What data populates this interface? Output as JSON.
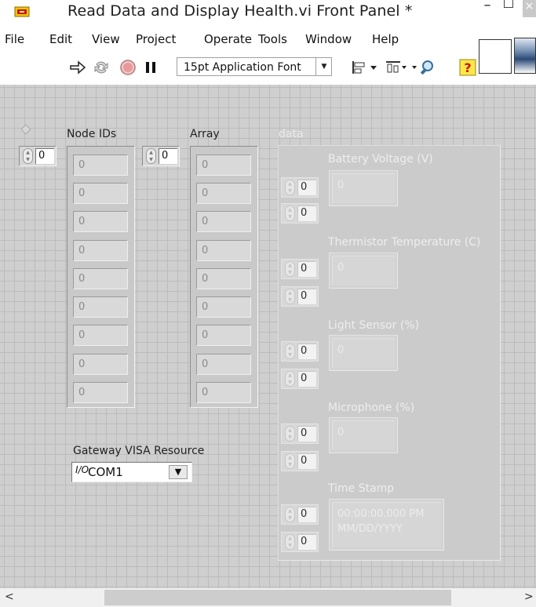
{
  "window": {
    "title": "Read Data and Display Health.vi Front Panel *",
    "minimize_glyph": "–",
    "close_glyph": "×"
  },
  "menu": [
    "File",
    "Edit",
    "View",
    "Project",
    "Operate",
    "Tools",
    "Window",
    "Help"
  ],
  "toolbar": {
    "font": "15pt Application Font",
    "icons": [
      "run-arrow-icon",
      "run-continuously-icon",
      "abort-icon",
      "pause-icon",
      "align-objects-icon",
      "distribute-objects-icon",
      "zoom-icon",
      "context-help-icon"
    ]
  },
  "panel": {
    "node_ids": {
      "label": "Node IDs",
      "index": "0",
      "elements": [
        "0",
        "0",
        "0",
        "0",
        "0",
        "0",
        "0",
        "0",
        "0"
      ]
    },
    "array": {
      "label": "Array",
      "index": "0",
      "elements": [
        "0",
        "0",
        "0",
        "0",
        "0",
        "0",
        "0",
        "0",
        "0"
      ]
    },
    "data": {
      "label": "data",
      "battery": {
        "label": "Battery Voltage (V)",
        "index1": "0",
        "index2": "0",
        "value": "0"
      },
      "thermistor": {
        "label": "Thermistor Temperature (C)",
        "index1": "0",
        "index2": "0",
        "value": "0"
      },
      "light": {
        "label": "Light Sensor (%)",
        "index1": "0",
        "index2": "0",
        "value": "0"
      },
      "microphone": {
        "label": "Microphone (%)",
        "index1": "0",
        "index2": "0",
        "value": "0"
      },
      "timestamp": {
        "label": "Time Stamp",
        "index1": "0",
        "index2": "0",
        "time": "00:00:00.000 PM",
        "date": "MM/DD/YYYY"
      }
    },
    "visa": {
      "label": "Gateway VISA Resource",
      "icon": "I/O",
      "value": "COM1"
    }
  },
  "scrollbar": {
    "left_arrow": "<",
    "right_arrow": ">"
  }
}
